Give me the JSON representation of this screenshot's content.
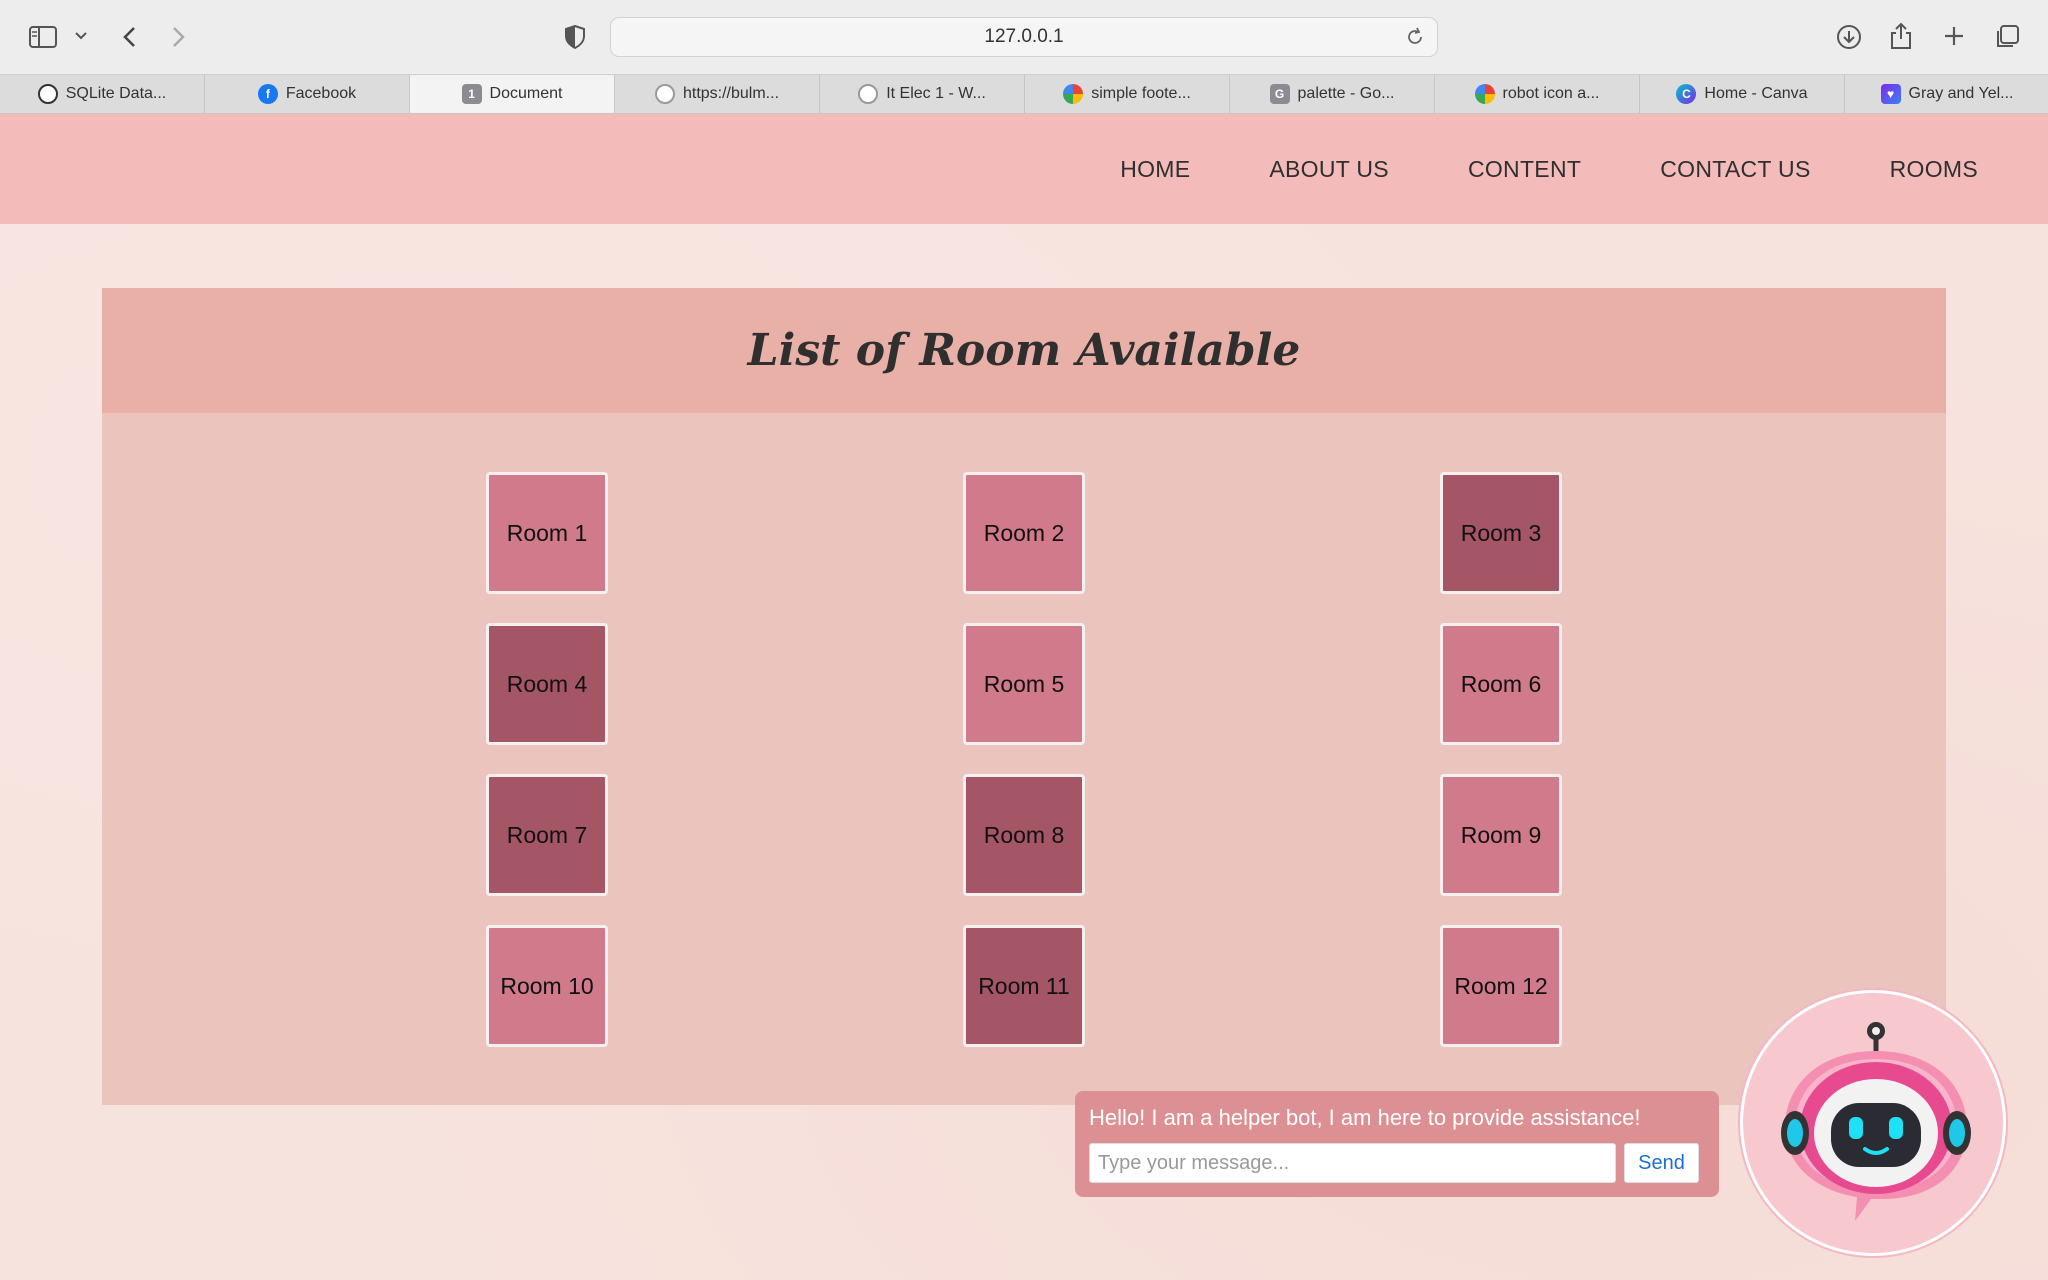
{
  "browser": {
    "url": "127.0.0.1",
    "tabs": [
      {
        "label": "SQLite Data...",
        "icon": "openai-icon",
        "active": false
      },
      {
        "label": "Facebook",
        "icon": "facebook-icon",
        "active": false
      },
      {
        "label": "Document",
        "icon": "document-icon",
        "active": true
      },
      {
        "label": "https://bulm...",
        "icon": "globe-icon",
        "active": false
      },
      {
        "label": "It Elec 1 - W...",
        "icon": "globe-icon",
        "active": false
      },
      {
        "label": "simple foote...",
        "icon": "google-icon",
        "active": false
      },
      {
        "label": "palette - Go...",
        "icon": "g-icon",
        "active": false
      },
      {
        "label": "robot icon a...",
        "icon": "google-icon",
        "active": false
      },
      {
        "label": "Home - Canva",
        "icon": "canva-icon",
        "active": false
      },
      {
        "label": "Gray and Yel...",
        "icon": "heart-icon",
        "active": false
      }
    ],
    "document_tab_badge": "1",
    "g_badge": "G"
  },
  "nav": {
    "home": "HOME",
    "about": "ABOUT US",
    "content": "CONTENT",
    "contact": "CONTACT US",
    "rooms": "ROOMS"
  },
  "rooms": {
    "title": "List of Room Available",
    "items": [
      {
        "label": "Room 1",
        "status": "available"
      },
      {
        "label": "Room 2",
        "status": "available"
      },
      {
        "label": "Room 3",
        "status": "occupied"
      },
      {
        "label": "Room 4",
        "status": "occupied"
      },
      {
        "label": "Room 5",
        "status": "available"
      },
      {
        "label": "Room 6",
        "status": "available"
      },
      {
        "label": "Room 7",
        "status": "occupied"
      },
      {
        "label": "Room 8",
        "status": "occupied"
      },
      {
        "label": "Room 9",
        "status": "available"
      },
      {
        "label": "Room 10",
        "status": "available"
      },
      {
        "label": "Room 11",
        "status": "occupied"
      },
      {
        "label": "Room 12",
        "status": "available"
      }
    ]
  },
  "chat": {
    "greeting": "Hello! I am a helper bot, I am here to provide assistance!",
    "placeholder": "Type your message...",
    "send_label": "Send"
  },
  "colors": {
    "nav_bg": "#f3bbba",
    "panel_bg": "#ecc4be",
    "panel_header_bg": "#e9b0a8",
    "room_available": "#d07a8b",
    "room_occupied": "#a45566",
    "chat_bg": "#dc9093",
    "send_text": "#1f6fd1"
  }
}
